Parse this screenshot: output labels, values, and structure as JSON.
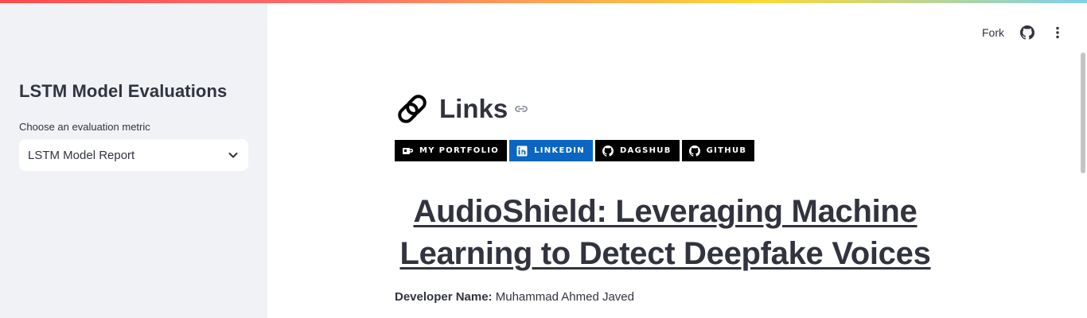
{
  "colors": {
    "sidebar_bg": "#f0f2f6",
    "text": "#31333f",
    "badge_black": "#000000",
    "badge_linkedin": "#0a66c2"
  },
  "sidebar": {
    "title": "LSTM Model Evaluations",
    "metric_label": "Choose an evaluation metric",
    "metric_select": {
      "selected": "LSTM Model Report",
      "icon": "chevron-down-icon"
    }
  },
  "toolbar": {
    "fork_label": "Fork",
    "github_icon": "github-icon",
    "menu_icon": "kebab-menu-icon"
  },
  "main": {
    "links_title": "Links",
    "links_logo": "link-chain-logo",
    "anchor_icon": "anchor-link-icon",
    "badges": [
      {
        "label": "MY PORTFOLIO",
        "icon": "portfolio-icon"
      },
      {
        "label": "LINKEDIN",
        "icon": "linkedin-icon"
      },
      {
        "label": "DAGSHUB",
        "icon": "github-icon"
      },
      {
        "label": "GITHUB",
        "icon": "github-icon"
      }
    ],
    "project_title": "AudioShield: Leveraging Machine Learning to Detect Deepfake Voices",
    "developer_label": "Developer Name:",
    "developer_name": "Muhammad Ahmed Javed"
  }
}
